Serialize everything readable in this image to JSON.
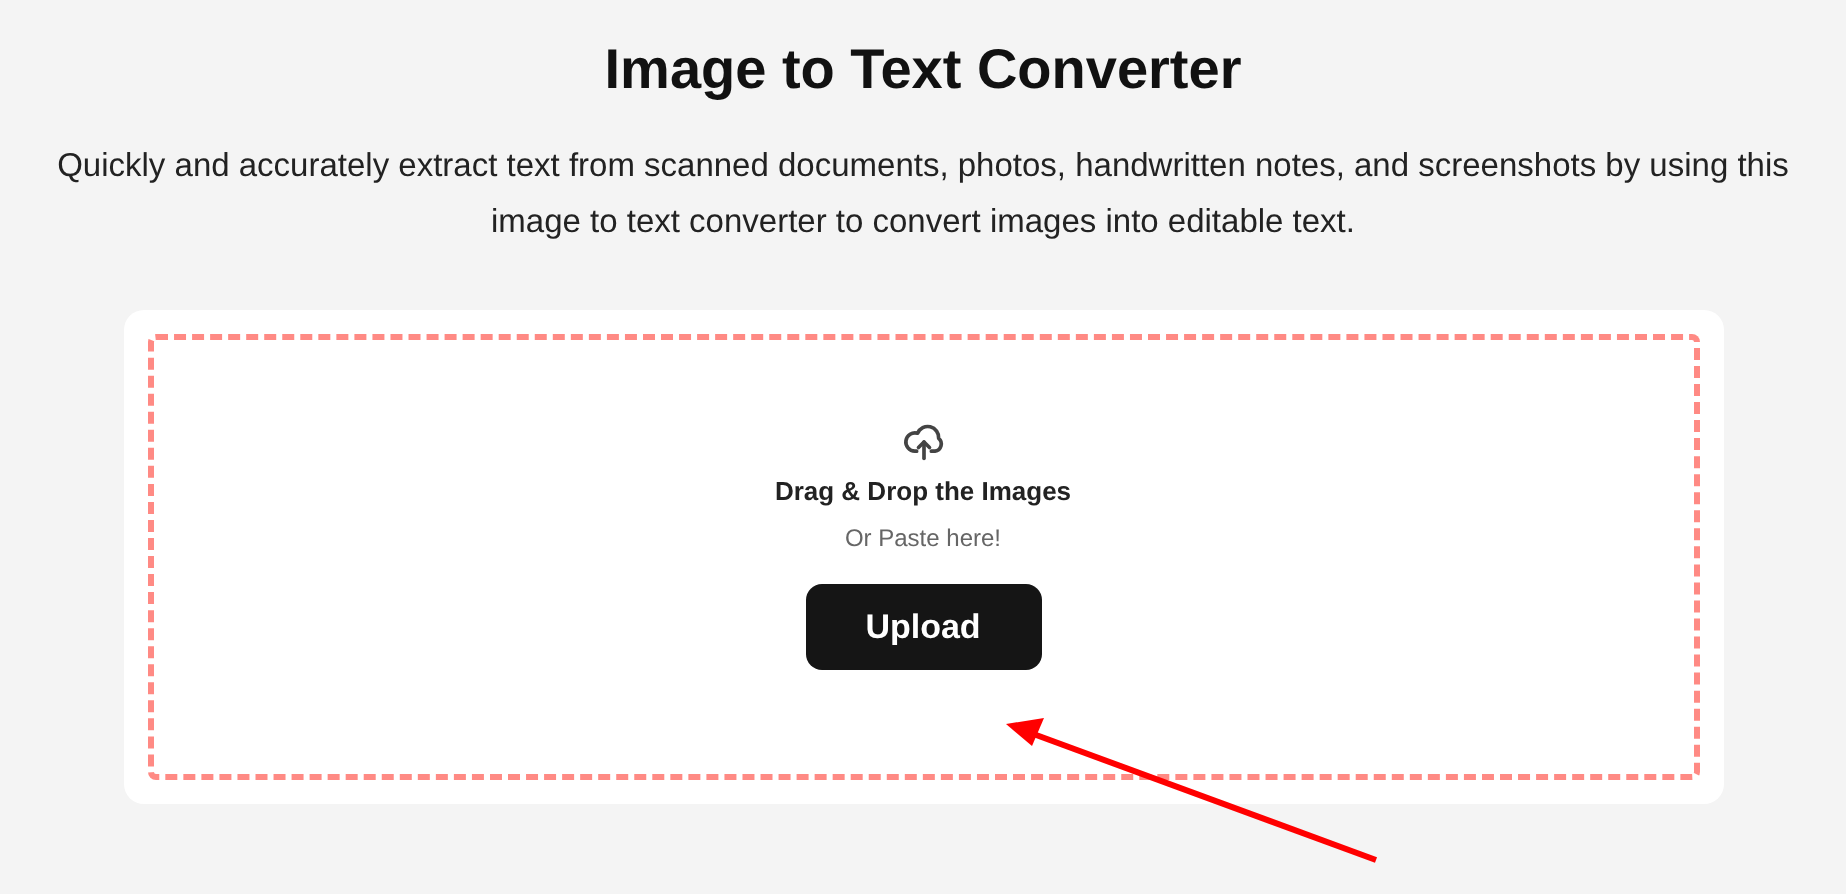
{
  "title": "Image to Text Converter",
  "description": "Quickly and accurately extract text from scanned documents, photos, handwritten notes, and screenshots by using this image to text converter to convert images into editable text.",
  "dropzone": {
    "heading": "Drag & Drop the Images",
    "hint": "Or Paste here!",
    "button": "Upload"
  }
}
